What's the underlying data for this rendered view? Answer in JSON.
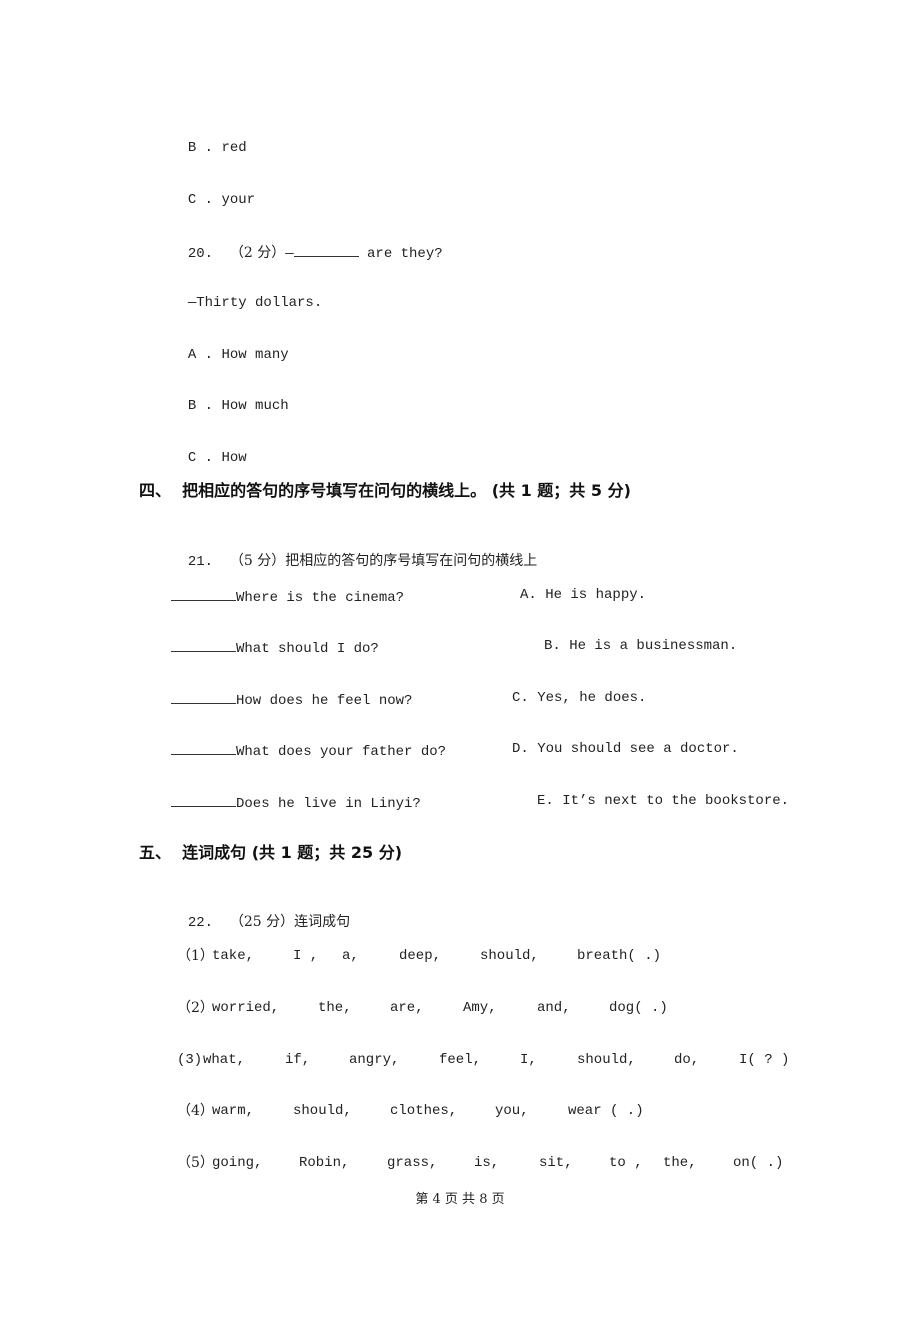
{
  "q19_options_tail": [
    {
      "letter": "B",
      "text": "red"
    },
    {
      "letter": "C",
      "text": "your"
    }
  ],
  "q20": {
    "number": "20.",
    "score": "（2 分）",
    "prompt_prefix": "—",
    "prompt_suffix": " are they?",
    "reply": "—Thirty dollars.",
    "options": [
      {
        "letter": "A",
        "text": "How many"
      },
      {
        "letter": "B",
        "text": "How much"
      },
      {
        "letter": "C",
        "text": "How"
      }
    ]
  },
  "section4": {
    "heading": "四、  把相应的答句的序号填写在问句的横线上。 (共 1 题；共 5 分)",
    "q21": {
      "number": "21.",
      "score": "（5 分）",
      "instruction": "把相应的答句的序号填写在问句的横线上",
      "pairs": [
        {
          "question": "Where is the cinema?",
          "answer": "A. He is happy."
        },
        {
          "question": "What should I do?",
          "answer": "B. He is a businessman."
        },
        {
          "question": "How does he feel now?",
          "answer": "C. Yes, he does."
        },
        {
          "question": "What does your father do?",
          "answer": "D. You should see a doctor."
        },
        {
          "question": "Does he live in Linyi?",
          "answer": "E. It’s next to the bookstore."
        }
      ]
    }
  },
  "section5": {
    "heading": "五、  连词成句 (共 1 题；共 25 分)",
    "q22": {
      "number": "22.",
      "score": "（25 分）",
      "instruction": "连词成句",
      "items": [
        {
          "label": "（1）",
          "words": [
            "take,",
            "I ,",
            "a,",
            "deep,",
            "should,",
            "breath( .)"
          ]
        },
        {
          "label": "（2）",
          "words": [
            "worried,",
            "the,",
            "are,",
            "Amy,",
            "and,",
            "dog( .)"
          ]
        },
        {
          "label": "(3)",
          "words": [
            "what,",
            "if,",
            "angry,",
            "feel,",
            "I,",
            "should,",
            "do,",
            "I( ? )"
          ]
        },
        {
          "label": "（4）",
          "words": [
            "warm,",
            "should,",
            "clothes,",
            "you,",
            "wear ( .)"
          ]
        },
        {
          "label": "（5）",
          "words": [
            "going,",
            "Robin,",
            "grass,",
            "is,",
            "sit,",
            "to ,",
            "the,",
            "on( .)"
          ]
        }
      ]
    }
  },
  "footer": {
    "page_label": "第 4 页 共 8 页"
  }
}
